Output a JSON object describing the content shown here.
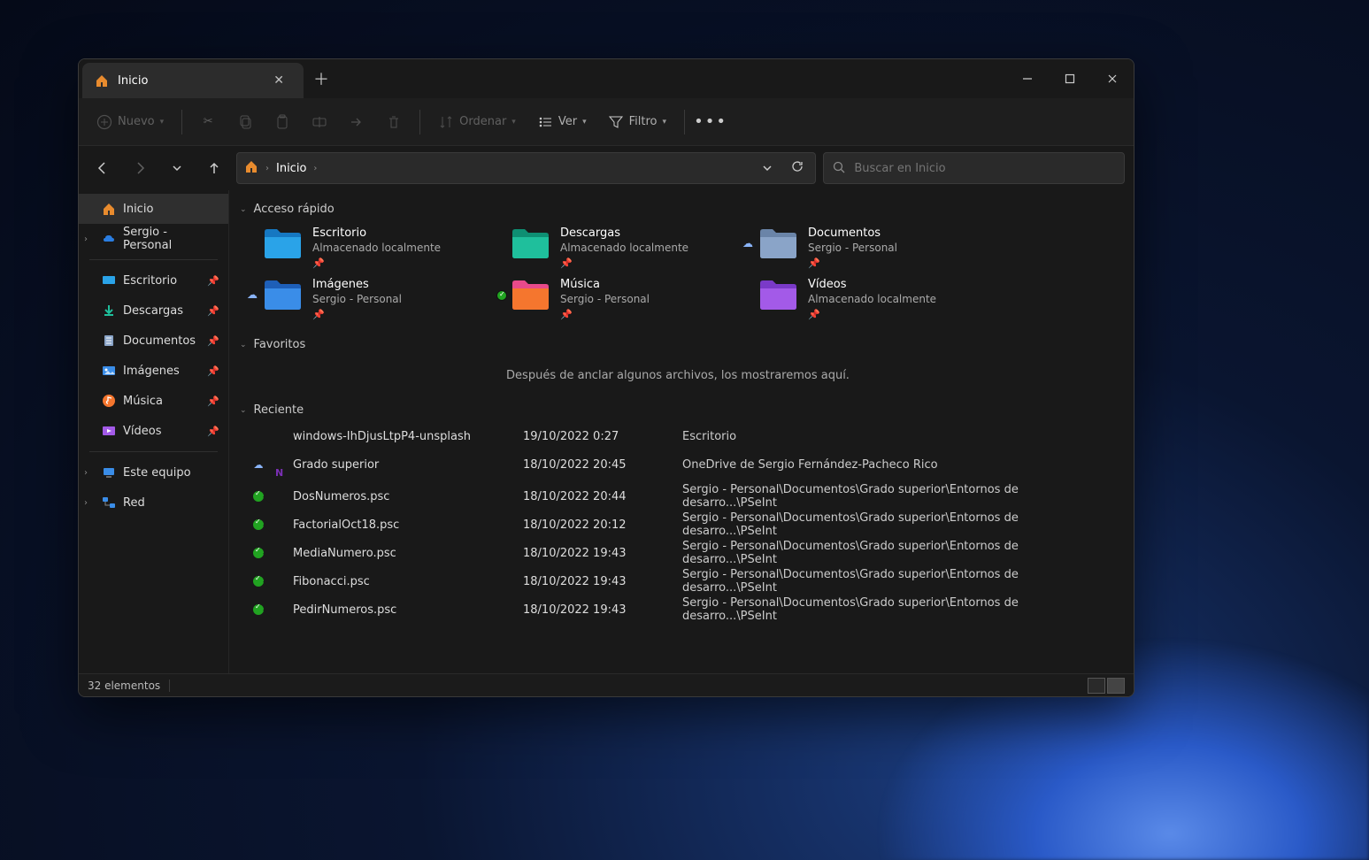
{
  "tab": {
    "title": "Inicio"
  },
  "toolbar": {
    "new": "Nuevo",
    "sort": "Ordenar",
    "view": "Ver",
    "filter": "Filtro"
  },
  "breadcrumb": {
    "current": "Inicio"
  },
  "search": {
    "placeholder": "Buscar en Inicio"
  },
  "sidebar": {
    "home": "Inicio",
    "onedrive": "Sergio - Personal",
    "desktop": "Escritorio",
    "downloads": "Descargas",
    "documents": "Documentos",
    "pictures": "Imágenes",
    "music": "Música",
    "videos": "Vídeos",
    "thispc": "Este equipo",
    "network": "Red"
  },
  "groups": {
    "quick": "Acceso rápido",
    "favorites": "Favoritos",
    "recent": "Reciente"
  },
  "quick": [
    {
      "name": "Escritorio",
      "sub": "Almacenado localmente",
      "color1": "#2aa3e8",
      "color2": "#1678c2",
      "badge": ""
    },
    {
      "name": "Descargas",
      "sub": "Almacenado localmente",
      "color1": "#1fbf9c",
      "color2": "#0e8f73",
      "badge": ""
    },
    {
      "name": "Documentos",
      "sub": "Sergio - Personal",
      "color1": "#8aa4c8",
      "color2": "#6a84a8",
      "badge": "cloud"
    },
    {
      "name": "Imágenes",
      "sub": "Sergio - Personal",
      "color1": "#3a8de8",
      "color2": "#1e5fb8",
      "badge": "cloud"
    },
    {
      "name": "Música",
      "sub": "Sergio - Personal",
      "color1": "#f5762e",
      "color2": "#e84a8a",
      "badge": "sync"
    },
    {
      "name": "Vídeos",
      "sub": "Almacenado localmente",
      "color1": "#a35ae8",
      "color2": "#7a3ac8",
      "badge": ""
    }
  ],
  "favorites_empty": "Después de anclar algunos archivos, los mostraremos aquí.",
  "recent": [
    {
      "icon": "image",
      "badge": "",
      "name": "windows-IhDjusLtpP4-unsplash",
      "date": "19/10/2022 0:27",
      "loc": "Escritorio"
    },
    {
      "icon": "onenote",
      "badge": "cloud",
      "name": "Grado superior",
      "date": "18/10/2022 20:45",
      "loc": "OneDrive de Sergio Fernández-Pacheco Rico"
    },
    {
      "icon": "file",
      "badge": "sync",
      "name": "DosNumeros.psc",
      "date": "18/10/2022 20:44",
      "loc": "Sergio - Personal\\Documentos\\Grado superior\\Entornos de desarro...\\PSeInt"
    },
    {
      "icon": "file",
      "badge": "sync",
      "name": "FactorialOct18.psc",
      "date": "18/10/2022 20:12",
      "loc": "Sergio - Personal\\Documentos\\Grado superior\\Entornos de desarro...\\PSeInt"
    },
    {
      "icon": "file",
      "badge": "sync",
      "name": "MediaNumero.psc",
      "date": "18/10/2022 19:43",
      "loc": "Sergio - Personal\\Documentos\\Grado superior\\Entornos de desarro...\\PSeInt"
    },
    {
      "icon": "file",
      "badge": "sync",
      "name": "Fibonacci.psc",
      "date": "18/10/2022 19:43",
      "loc": "Sergio - Personal\\Documentos\\Grado superior\\Entornos de desarro...\\PSeInt"
    },
    {
      "icon": "file",
      "badge": "sync",
      "name": "PedirNumeros.psc",
      "date": "18/10/2022 19:43",
      "loc": "Sergio - Personal\\Documentos\\Grado superior\\Entornos de desarro...\\PSeInt"
    }
  ],
  "status": {
    "count": "32 elementos"
  }
}
